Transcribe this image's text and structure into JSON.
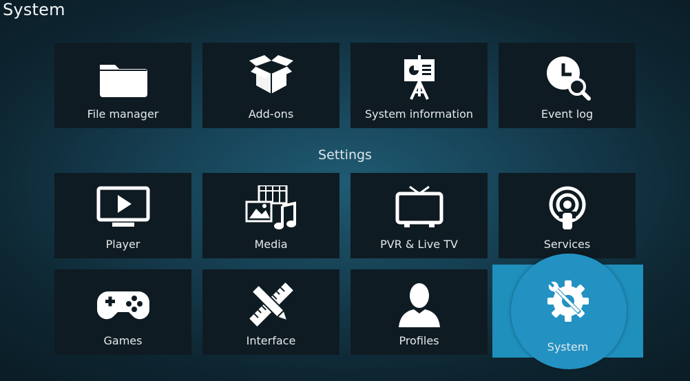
{
  "page": {
    "title": "System"
  },
  "top_row": [
    {
      "label": "File manager",
      "icon": "folder-icon"
    },
    {
      "label": "Add-ons",
      "icon": "open-box-icon"
    },
    {
      "label": "System information",
      "icon": "presentation-board-icon"
    },
    {
      "label": "Event log",
      "icon": "clock-search-icon"
    }
  ],
  "settings": {
    "heading": "Settings",
    "items": [
      {
        "label": "Player",
        "icon": "monitor-play-icon"
      },
      {
        "label": "Media",
        "icon": "media-library-icon"
      },
      {
        "label": "PVR & Live TV",
        "icon": "tv-antenna-icon"
      },
      {
        "label": "Services",
        "icon": "podcast-broadcast-icon"
      },
      {
        "label": "Games",
        "icon": "gamepad-icon"
      },
      {
        "label": "Interface",
        "icon": "pencil-ruler-icon"
      },
      {
        "label": "Profiles",
        "icon": "user-silhouette-icon"
      },
      {
        "label": "System",
        "icon": "gear-wrench-icon",
        "focused": true
      }
    ]
  },
  "colors": {
    "tile_background": "#0f1b22",
    "focus_accent": "#2392c2",
    "text": "#e4e9ec"
  }
}
